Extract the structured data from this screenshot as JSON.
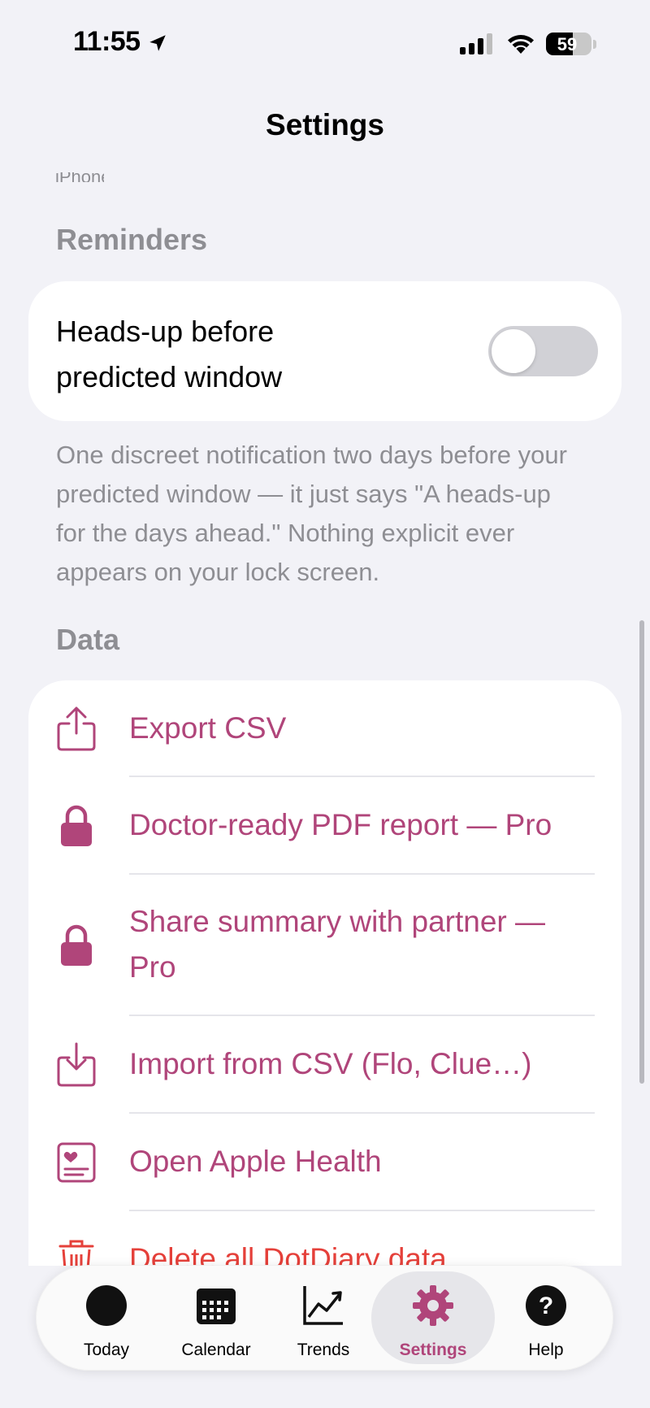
{
  "status_bar": {
    "time": "11:55",
    "battery": "59",
    "battery_level": 0.59
  },
  "nav": {
    "title": "Settings"
  },
  "clipped_text": "iPhone",
  "reminders": {
    "header": "Reminders",
    "toggle_label": "Heads-up before predicted window",
    "toggle_on": false,
    "footer": "One discreet notification two days before your predicted window — it just says \"A heads-up for the days ahead.\" Nothing explicit ever appears on your lock screen."
  },
  "data_section": {
    "header": "Data",
    "items": [
      {
        "label": "Export CSV",
        "icon": "share-icon"
      },
      {
        "label": "Doctor-ready PDF report — Pro",
        "icon": "lock-icon"
      },
      {
        "label": "Share summary with partner — Pro",
        "icon": "lock-icon"
      },
      {
        "label": "Import from CSV (Flo, Clue…)",
        "icon": "import-icon"
      },
      {
        "label": "Open Apple Health",
        "icon": "health-record-icon"
      },
      {
        "label": "Delete all DotDiary data",
        "icon": "trash-icon"
      }
    ]
  },
  "tabbar": {
    "tabs": [
      {
        "label": "Today",
        "icon": "filled-circle-icon"
      },
      {
        "label": "Calendar",
        "icon": "calendar-icon"
      },
      {
        "label": "Trends",
        "icon": "chart-icon"
      },
      {
        "label": "Settings",
        "icon": "gear-icon",
        "active": true
      },
      {
        "label": "Help",
        "icon": "question-icon"
      }
    ]
  },
  "colors": {
    "accent": "#B0457A",
    "danger": "#E5403A",
    "background": "#F2F2F7",
    "secondary_text": "#8E8E93"
  }
}
